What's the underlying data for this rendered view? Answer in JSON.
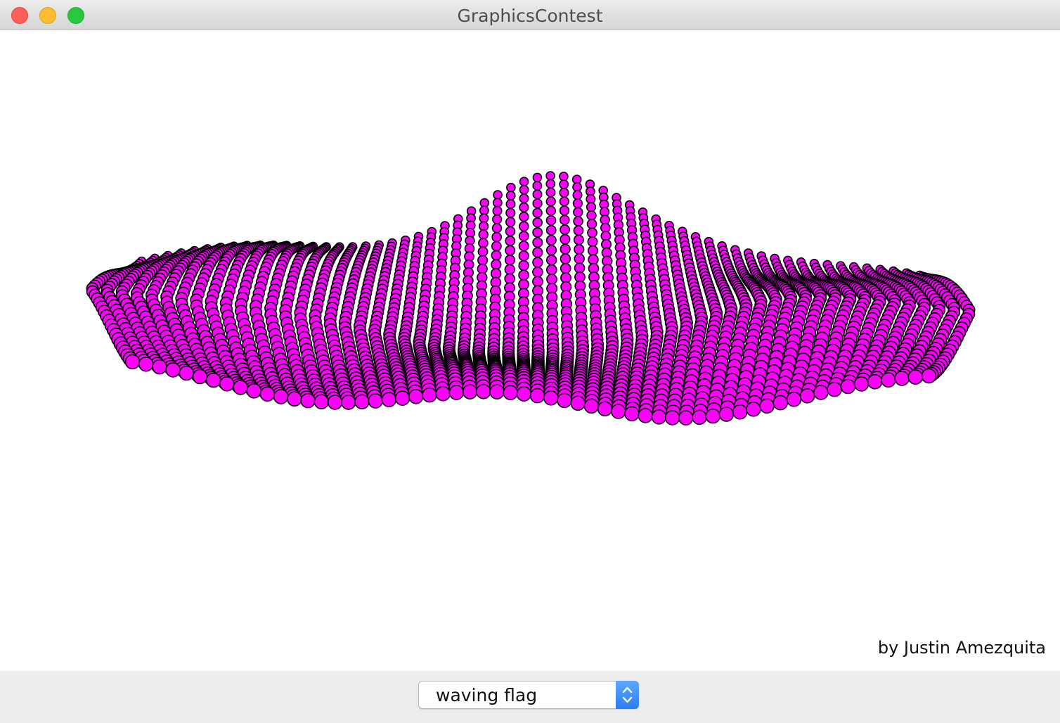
{
  "window": {
    "title": "GraphicsContest"
  },
  "canvas": {
    "credit": "by Justin Amezquita",
    "flag_fill_color": "#ff00ff",
    "flag_outline_color": "#000000"
  },
  "controls": {
    "animation_select": {
      "selected": "waving flag"
    }
  },
  "icons": {
    "close": "close-icon",
    "minimize": "minimize-icon",
    "zoom": "zoom-icon",
    "select_arrows": "up-down-chevron-icon"
  }
}
